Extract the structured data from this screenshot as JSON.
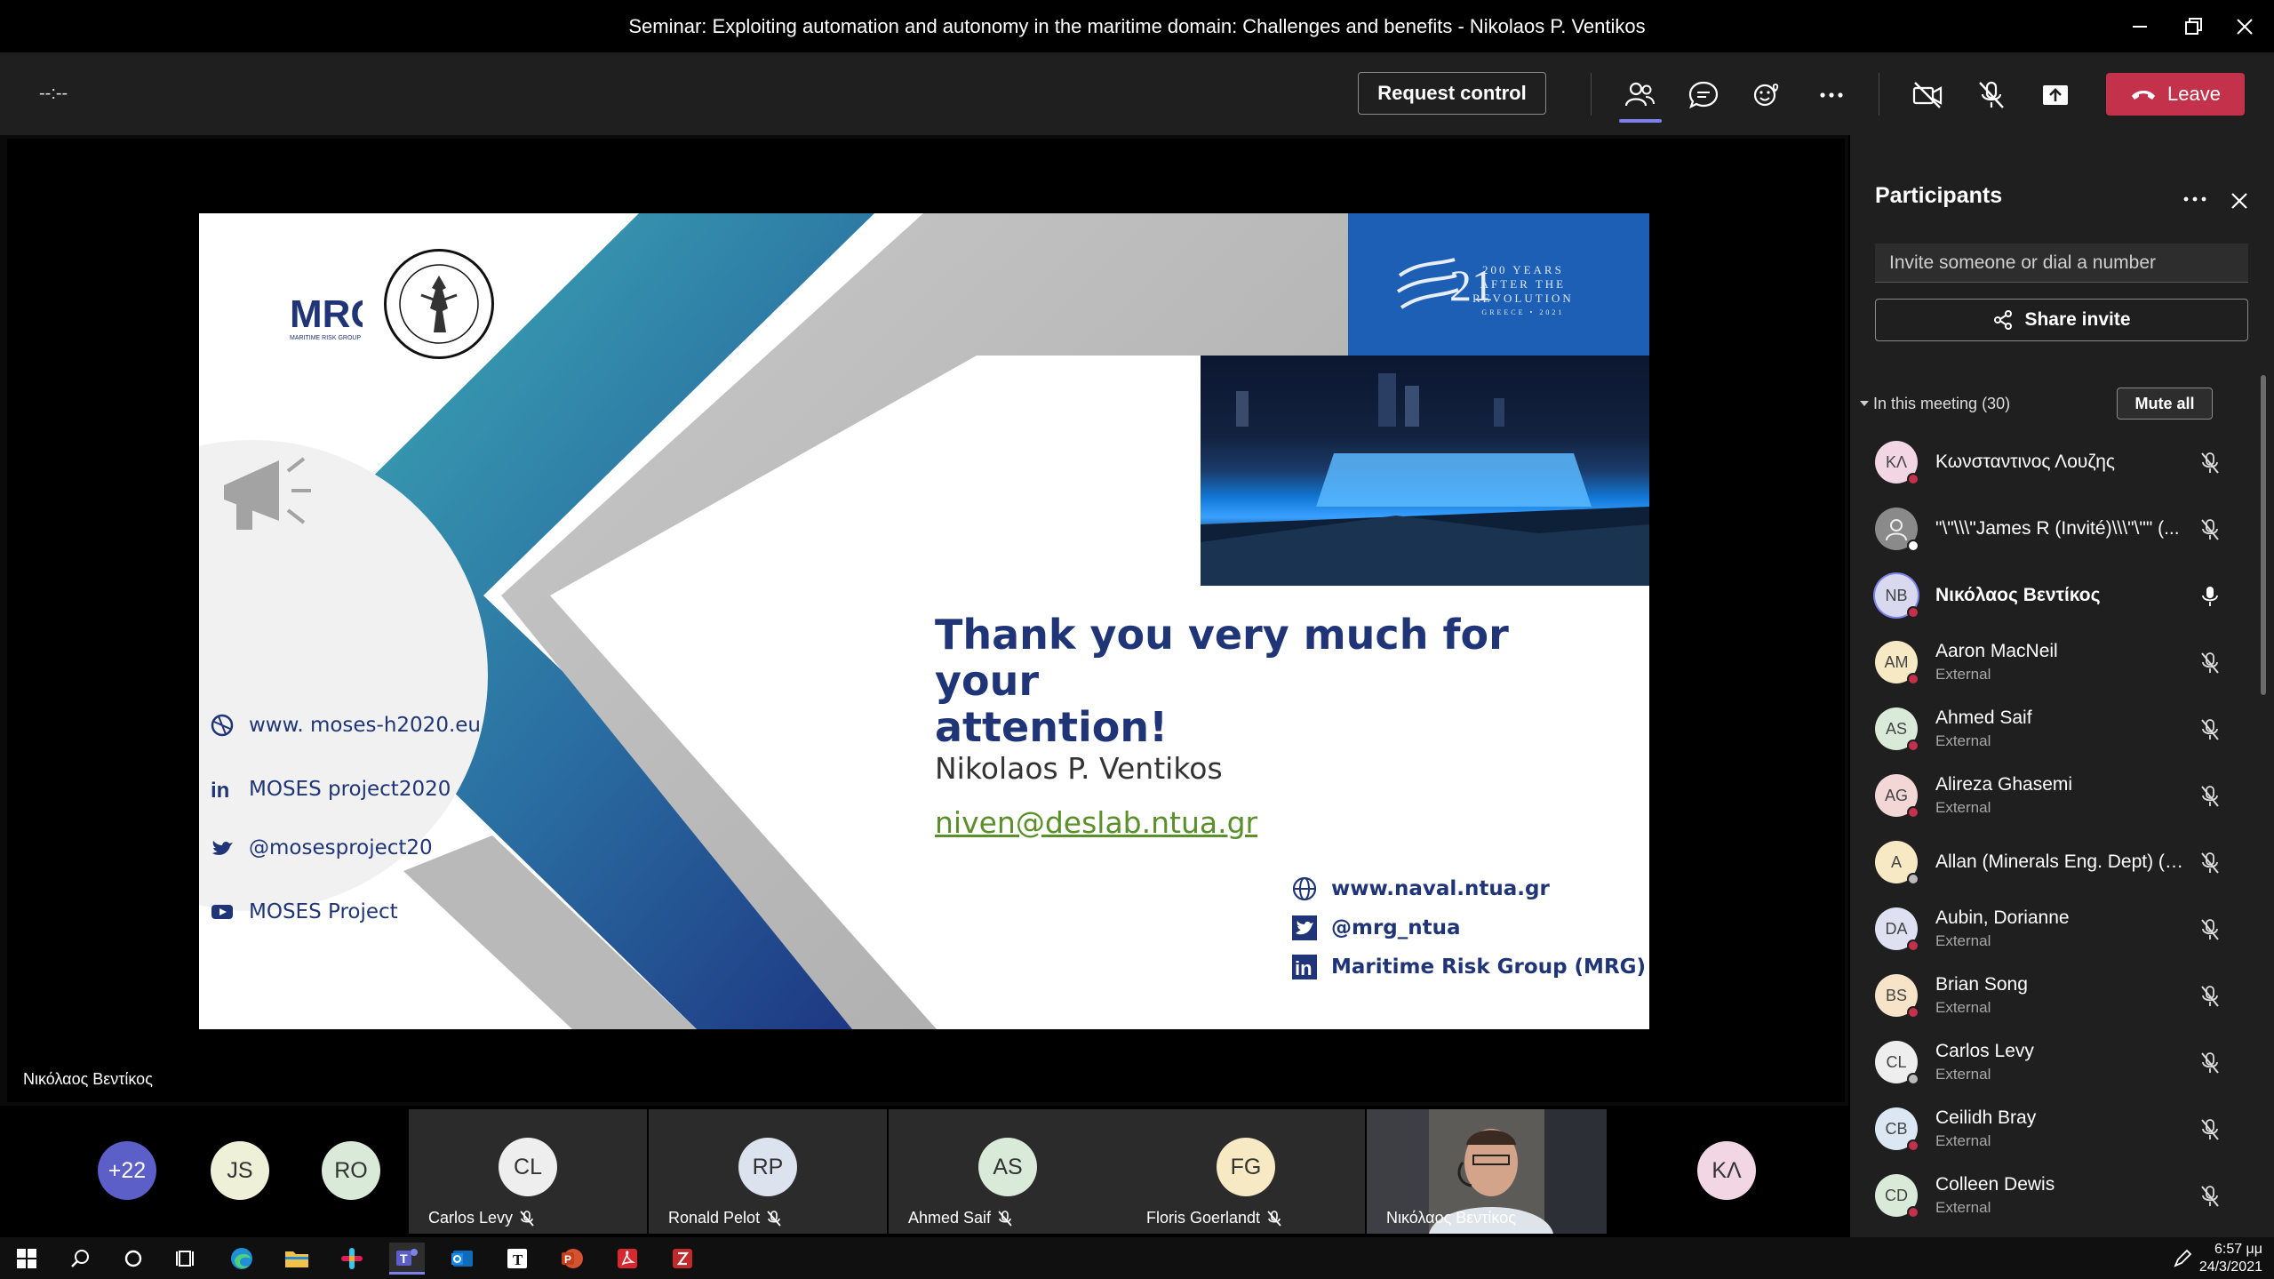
{
  "window": {
    "title": "Seminar: Exploiting automation and autonomy in the maritime domain: Challenges and benefits - Nikolaos P. Ventikos"
  },
  "toolbar": {
    "timer": "--:--",
    "request_control_label": "Request control",
    "leave_label": "Leave",
    "icons": [
      "people-icon",
      "chat-icon",
      "reactions-icon",
      "more-icon",
      "camera-off-icon",
      "mic-off-icon",
      "share-tray-icon",
      "phone-icon"
    ],
    "leave_color": "#c4314b",
    "accent_color": "#7b83eb"
  },
  "stage": {
    "presenter_label": "Νικόλαος Βεντίκος"
  },
  "slide": {
    "mrg_logo_text": "MRG",
    "mrg_logo_sub": "MARITIME RISK GROUP",
    "banner_numeral": "21",
    "banner_lines": [
      "200 YEARS",
      "AFTER THE",
      "REVOLUTION",
      "GREECE • 2021"
    ],
    "heading_line1": "Thank you very much for your",
    "heading_line2": "attention!",
    "presenter_name": "Nikolaos P. Ventikos",
    "email": "niven@deslab.ntua.gr",
    "left_links": [
      {
        "icon": "web-icon",
        "text": "www. moses-h2020.eu"
      },
      {
        "icon": "linkedin-icon",
        "text": "MOSES project2020"
      },
      {
        "icon": "twitter-icon",
        "text": "@mosesproject20"
      },
      {
        "icon": "youtube-icon",
        "text": "MOSES Project"
      }
    ],
    "right_links": [
      {
        "icon": "globe-icon",
        "text": "www.naval.ntua.gr"
      },
      {
        "icon": "twitter-icon",
        "text": "@mrg_ntua"
      },
      {
        "icon": "linkedin-icon",
        "text": "Maritime Risk Group (MRG)"
      }
    ],
    "heading_color": "#1f3577",
    "email_color": "#5a8f2a"
  },
  "panel": {
    "title": "Participants",
    "invite_placeholder": "Invite someone or dial a number",
    "share_invite_label": "Share invite",
    "in_meeting_label": "In this meeting (30)",
    "mute_all_label": "Mute all",
    "participants": [
      {
        "initials": "ΚΛ",
        "name": "Κωνσταντινος Λουζης",
        "sub": "",
        "color": "#f3d6e3",
        "status": "busy",
        "mic": "mic-off-icon"
      },
      {
        "initials": "",
        "name": "\"\\\"\\\\\\\"James R (Invité)\\\\\\\"\\\"\" (...",
        "sub": "",
        "color": "#8a8a8a",
        "status": "available",
        "mic": "mic-off-icon"
      },
      {
        "initials": "NB",
        "name": "Νικόλαος Βεντίκος",
        "sub": "",
        "color": "#d8d8ee",
        "status": "busy",
        "mic": "mic-on-icon",
        "bold": true
      },
      {
        "initials": "AM",
        "name": "Aaron MacNeil",
        "sub": "External",
        "color": "#f6e9c3",
        "status": "busy",
        "mic": "mic-off-icon"
      },
      {
        "initials": "AS",
        "name": "Ahmed Saif",
        "sub": "External",
        "color": "#d9ead9",
        "status": "busy",
        "mic": "mic-off-icon"
      },
      {
        "initials": "AG",
        "name": "Alireza Ghasemi",
        "sub": "External",
        "color": "#f3d6d6",
        "status": "busy",
        "mic": "mic-off-icon"
      },
      {
        "initials": "A",
        "name": "Allan (Minerals Eng. Dept) (G...",
        "sub": "",
        "color": "#f6e9c3",
        "status": "offline",
        "mic": "mic-off-icon"
      },
      {
        "initials": "DA",
        "name": "Aubin, Dorianne",
        "sub": "External",
        "color": "#dfe1f2",
        "status": "busy",
        "mic": "mic-off-icon"
      },
      {
        "initials": "BS",
        "name": "Brian Song",
        "sub": "External",
        "color": "#f6e3c8",
        "status": "busy",
        "mic": "mic-off-icon"
      },
      {
        "initials": "CL",
        "name": "Carlos Levy",
        "sub": "External",
        "color": "#eeeeee",
        "status": "offline",
        "mic": "mic-off-icon"
      },
      {
        "initials": "CB",
        "name": "Ceilidh Bray",
        "sub": "External",
        "color": "#dbe7f3",
        "status": "busy",
        "mic": "mic-off-icon"
      },
      {
        "initials": "CD",
        "name": "Colleen Dewis",
        "sub": "External",
        "color": "#d9ead9",
        "status": "busy",
        "mic": "mic-off-icon"
      }
    ]
  },
  "strip": {
    "overflow": "+22",
    "avatars": [
      {
        "initials": "JS",
        "color": "#eef0d8"
      },
      {
        "initials": "RO",
        "color": "#d9ead9"
      }
    ],
    "tiles": [
      {
        "initials": "CL",
        "label": "Carlos Levy",
        "color": "#eeeeee"
      },
      {
        "initials": "RP",
        "label": "Ronald Pelot",
        "color": "#dbe3ee"
      },
      {
        "initials": "AS",
        "label": "Ahmed Saif",
        "color": "#d9ead9"
      },
      {
        "initials": "FG",
        "label": "Floris Goerlandt",
        "color": "#f6e9c3"
      }
    ],
    "video_label": "Νικόλαος Βεντίκος",
    "last_avatar": {
      "initials": "ΚΛ",
      "color": "#f3d6e3"
    }
  },
  "taskbar": {
    "time": "6:57 μμ",
    "date": "24/3/2021"
  }
}
